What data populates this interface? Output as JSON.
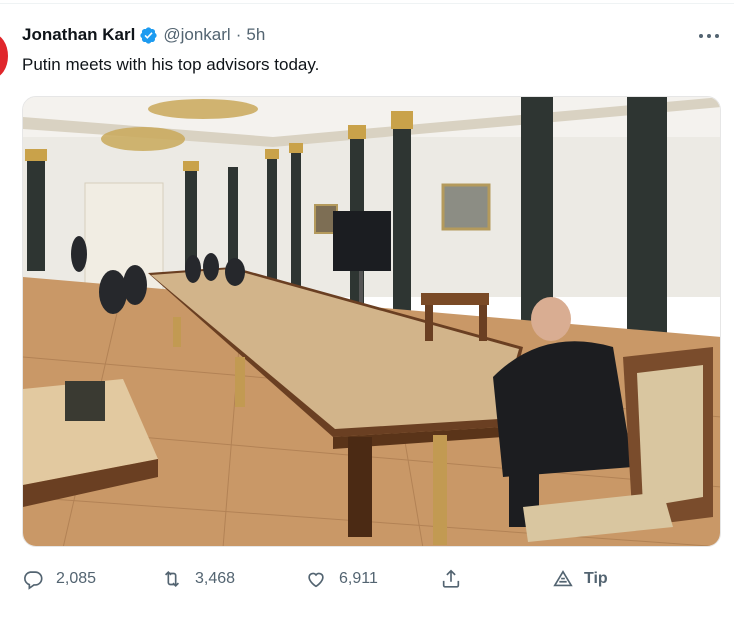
{
  "tweet": {
    "author_name": "Jonathan Karl",
    "handle": "@jonkarl",
    "separator": "·",
    "time": "5h",
    "text": "Putin meets with his top advisors today.",
    "verified": true
  },
  "photo": {
    "description_icon": "photo"
  },
  "actions": {
    "reply_count": "2,085",
    "retweet_count": "3,468",
    "like_count": "6,911",
    "tip_label": "Tip"
  },
  "colors": {
    "text": "#0f1419",
    "secondary": "#536471",
    "verified": "#1d9bf0",
    "avatar": "#e0262b"
  }
}
